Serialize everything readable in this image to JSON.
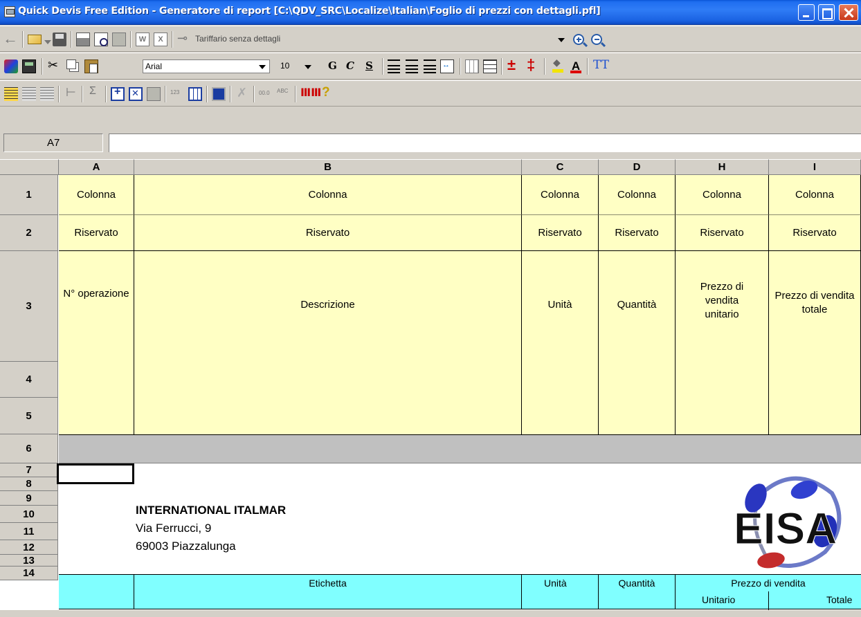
{
  "window": {
    "title": "Quick Devis Free Edition - Generatore di report [C:\\QDV_SRC\\Localize\\Italian\\Foglio di prezzi con dettagli.pfl]"
  },
  "toolbar1": {
    "template_combo": "Tariffario senza dettagli"
  },
  "toolbar2": {
    "font_name": "Arial",
    "font_size": "10",
    "bold": "G",
    "italic": "C",
    "underline": "S",
    "font_color_letter": "A"
  },
  "formula_bar": {
    "cell_ref": "A7",
    "value": ""
  },
  "grid": {
    "columns": [
      "A",
      "B",
      "C",
      "D",
      "H",
      "I"
    ],
    "rows": [
      "1",
      "2",
      "3",
      "4",
      "5",
      "6",
      "7",
      "8",
      "9",
      "10",
      "11",
      "12",
      "13",
      "14"
    ],
    "row1": [
      "Colonna",
      "Colonna",
      "Colonna",
      "Colonna",
      "Colonna",
      "Colonna"
    ],
    "row2": [
      "Riservato",
      "Riservato",
      "Riservato",
      "Riservato",
      "Riservato",
      "Riservato"
    ],
    "row3": [
      "N° operazione",
      "Descrizione",
      "Unità",
      "Quantità",
      "Prezzo di vendita unitario",
      "Prezzo di vendita totale"
    ]
  },
  "company": {
    "name": "INTERNATIONAL ITALMAR",
    "address": "Via Ferrucci, 9",
    "city": "69003 Piazzalunga",
    "logo": "EISA"
  },
  "footer_header": {
    "label": "Etichetta",
    "unit": "Unità",
    "quantity": "Quantità",
    "price": "Prezzo di vendita",
    "unit_price": "Unitario",
    "total": "Totale"
  }
}
